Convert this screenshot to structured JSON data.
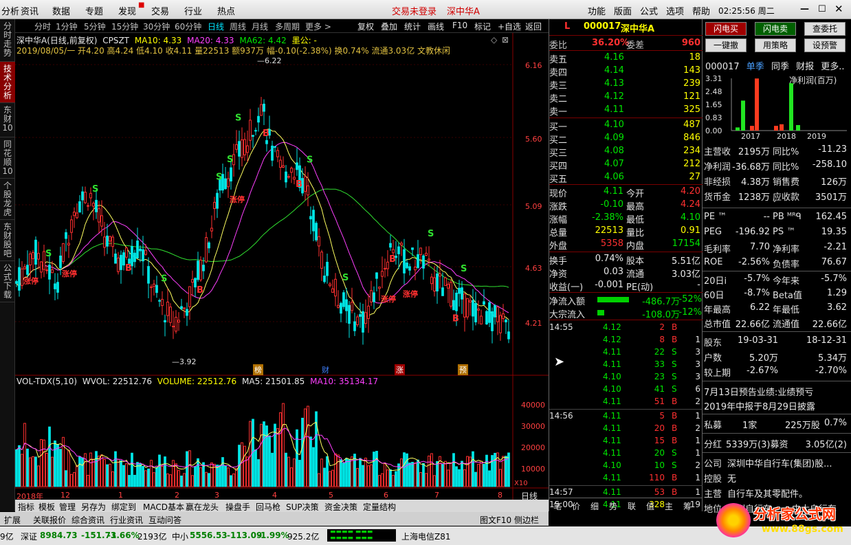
{
  "topbar": {
    "menu": [
      "分析",
      "资讯",
      "数据",
      "专题",
      "发现",
      "交易",
      "行业",
      "热点"
    ],
    "trade_status": "交易未登录",
    "stock": "深中华A",
    "right_menu": [
      "功能",
      "版面",
      "公式",
      "选项",
      "帮助"
    ],
    "time": "02:25:56",
    "weekday": "周二"
  },
  "leftnav": [
    "分时走势",
    "技术分析",
    "东财10",
    "同花顺10",
    "个股龙虎",
    "东财股吧",
    "公式下载"
  ],
  "period": {
    "tabs": [
      "分时",
      "1分钟",
      "5分钟",
      "15分钟",
      "30分钟",
      "60分钟",
      "日线",
      "周线",
      "月线",
      "多周期",
      "更多 >"
    ],
    "active": "日线",
    "tools": [
      "复权",
      "叠加",
      "统计",
      "画线",
      "F10",
      "标记",
      "+自选",
      "返回"
    ]
  },
  "chart": {
    "title": "深中华A(日线,前复权)",
    "indicator": "CPSZT",
    "ma10": "MA10: 4.33",
    "ma20": "MA20: 4.33",
    "ma62": "MA62: 4.42",
    "moqi": "墨公: -",
    "info": "2019/08/05/一 开4.20 高4.24 低4.10 收4.11 量22513 额937万 幅-0.10(-2.38%) 换0.74% 流通3.03亿 文教休闲",
    "high_label": "6.22",
    "low_label": "3.92",
    "y_ticks": [
      "6.16",
      "5.60",
      "5.09",
      "4.63",
      "4.21"
    ],
    "event_tags": [
      "榜",
      "财",
      "涨",
      "预"
    ],
    "vol_title": "VOL-TDX(5,10)",
    "vol_wvol": "WVOL: 22512.76",
    "vol_volume": "VOLUME: 22512.76",
    "vol_ma5": "MA5: 21501.85",
    "vol_ma10": "MA10: 35134.17",
    "vol_ticks": [
      "40000",
      "30000",
      "20000",
      "10000",
      "X10"
    ],
    "x_labels": [
      "2018年",
      "12",
      "1",
      "2",
      "3",
      "4",
      "5",
      "6",
      "7",
      "8"
    ],
    "period_label": "日线"
  },
  "toolbar": [
    "指标",
    "模板",
    "管理",
    "另存为",
    "绑定到",
    "MACD基本",
    "赢在龙头",
    "操盘手",
    "回马枪",
    "SUP决策",
    "资金决策",
    "定量结构"
  ],
  "toolbar2": [
    "扩展",
    "关联报价",
    "综合资讯",
    "行业资讯",
    "互动问答"
  ],
  "toolbar2_right": "图文F10 侧边栏",
  "quote": {
    "L": "L",
    "code": "000017",
    "name": "深中华A",
    "weibi_label": "委比",
    "weibi": "36.20%",
    "weicha_label": "委差",
    "weicha": "960",
    "asks": [
      [
        "卖五",
        "4.16",
        "18"
      ],
      [
        "卖四",
        "4.14",
        "143"
      ],
      [
        "卖三",
        "4.13",
        "239"
      ],
      [
        "卖二",
        "4.12",
        "121"
      ],
      [
        "卖一",
        "4.11",
        "325"
      ]
    ],
    "bids": [
      [
        "买一",
        "4.10",
        "487"
      ],
      [
        "买二",
        "4.09",
        "846"
      ],
      [
        "买三",
        "4.08",
        "234"
      ],
      [
        "买四",
        "4.07",
        "212"
      ],
      [
        "买五",
        "4.06",
        "27"
      ]
    ],
    "stats": [
      [
        "现价",
        "4.11",
        "今开",
        "4.20"
      ],
      [
        "涨跌",
        "-0.10",
        "最高",
        "4.24"
      ],
      [
        "涨幅",
        "-2.38%",
        "最低",
        "4.10"
      ],
      [
        "总量",
        "22513",
        "量比",
        "0.91"
      ],
      [
        "外盘",
        "5358",
        "内盘",
        "17154"
      ],
      [
        "换手",
        "0.74%",
        "股本",
        "5.51亿"
      ],
      [
        "净资",
        "0.03",
        "流通",
        "3.03亿"
      ],
      [
        "收益(一)",
        "-0.001",
        "PE(动)",
        "-"
      ]
    ],
    "flow": [
      [
        "净流入额",
        "-486.7万",
        "-52%"
      ],
      [
        "大宗流入",
        "-108.0万",
        "-12%"
      ]
    ],
    "ticks": [
      [
        "14:55",
        "4.12",
        "2",
        "B",
        ""
      ],
      [
        "",
        "4.12",
        "8",
        "B",
        "1"
      ],
      [
        "",
        "4.11",
        "22",
        "S",
        "3"
      ],
      [
        "",
        "4.11",
        "33",
        "S",
        "3"
      ],
      [
        "",
        "4.10",
        "23",
        "S",
        "3"
      ],
      [
        "",
        "4.10",
        "41",
        "S",
        "6"
      ],
      [
        "",
        "4.11",
        "51",
        "B",
        "2"
      ],
      [
        "14:56",
        "4.11",
        "5",
        "B",
        "1"
      ],
      [
        "",
        "4.11",
        "20",
        "B",
        "2"
      ],
      [
        "",
        "4.11",
        "15",
        "B",
        "1"
      ],
      [
        "",
        "4.11",
        "20",
        "S",
        "1"
      ],
      [
        "",
        "4.10",
        "10",
        "S",
        "2"
      ],
      [
        "",
        "4.11",
        "110",
        "B",
        "1"
      ],
      [
        "14:57",
        "4.11",
        "53",
        "B",
        "1"
      ],
      [
        "15:00",
        "4.11",
        "328",
        "",
        "19"
      ]
    ],
    "bottom_tabs": [
      "笔",
      "价",
      "细",
      "势",
      "联",
      "值",
      "主",
      "筹"
    ]
  },
  "right": {
    "buttons": [
      "闪电买",
      "闪电卖",
      "查委托",
      "一键撤",
      "用策略",
      "设预警"
    ],
    "fin_head": [
      "000017",
      "单季",
      "同季",
      "财报",
      "更多.."
    ],
    "fin_y": [
      "3.31",
      "2.48",
      "1.65",
      "0.83",
      "0.00"
    ],
    "fin_title": "净利润(百万)",
    "fin_x": [
      "2017",
      "2018",
      "2019"
    ],
    "fin_bars": [
      {
        "v": 0.2,
        "c": "g"
      },
      {
        "v": 1.9,
        "c": "g"
      },
      {
        "v": 0.3,
        "c": "r"
      },
      {
        "v": 3.3,
        "c": "r"
      },
      {
        "v": 0.3,
        "c": "r"
      },
      {
        "v": 0.4,
        "c": "r"
      },
      {
        "v": 3.0,
        "c": "g"
      },
      {
        "v": 0.35,
        "c": "g"
      }
    ],
    "rows1": [
      [
        "主营收",
        "2195万",
        "同比%",
        "-11.23"
      ],
      [
        "净利润",
        "-36.68万",
        "同比%",
        "-258.10"
      ],
      [
        "非经损",
        "4.38万",
        "销售费",
        "126万"
      ],
      [
        "货币金",
        "1238万",
        "应收款",
        "3501万"
      ]
    ],
    "rows2": [
      [
        "PE ™",
        "--",
        "PB ᴹᴿᑫ",
        "162.45"
      ],
      [
        "PEG",
        "-196.92",
        "PS ™",
        "19.35"
      ],
      [
        "毛利率",
        "7.70",
        "净利率",
        "-2.21"
      ],
      [
        "ROE",
        "-2.56%",
        "负债率",
        "76.67"
      ]
    ],
    "rows3": [
      [
        "20日i",
        "-5.7%",
        "今年来",
        "-5.7%"
      ],
      [
        "60日",
        "-8.7%",
        "Beta值",
        "1.29"
      ],
      [
        "年最高",
        "6.22",
        "年最低",
        "3.62"
      ],
      [
        "总市值",
        "22.66亿",
        "流通值",
        "22.66亿"
      ]
    ],
    "rows4": [
      [
        "股东",
        "19-03-31",
        "18-12-31"
      ],
      [
        "户数",
        "5.20万",
        "5.34万"
      ],
      [
        "较上期",
        "-2.67%",
        "-2.70%"
      ]
    ],
    "news": [
      "7月13日预告业绩:业绩预亏",
      "2019年中报于8月29日披露"
    ],
    "private": [
      "私募",
      "1家",
      "225万股",
      "0.7%"
    ],
    "dividend": [
      "分红",
      "5339万(3)募资",
      "3.05亿(2)"
    ],
    "company": [
      "公司",
      "深圳中华自行车(集团)股..."
    ],
    "holder": [
      "控股",
      "无"
    ],
    "business": [
      "主营",
      "自行车及其零配件。"
    ],
    "region": [
      "地位",
      "深圳自行车",
      "中大自行车"
    ]
  },
  "status": {
    "sh": "9亿",
    "sz_label": "深证",
    "sz": "8984.73",
    "sz_chg": "-151.73",
    "sz_pct": "-1.66%",
    "sz_amt": "2193亿",
    "zx_label": "中小",
    "zx": "5556.53",
    "zx_chg": "-113.09",
    "zx_pct": "-1.99%",
    "zx_amt": "925.2亿",
    "net": "上海电信Z81"
  },
  "watermark": {
    "title": "分析家公式网",
    "url": "www.88gs.com"
  }
}
